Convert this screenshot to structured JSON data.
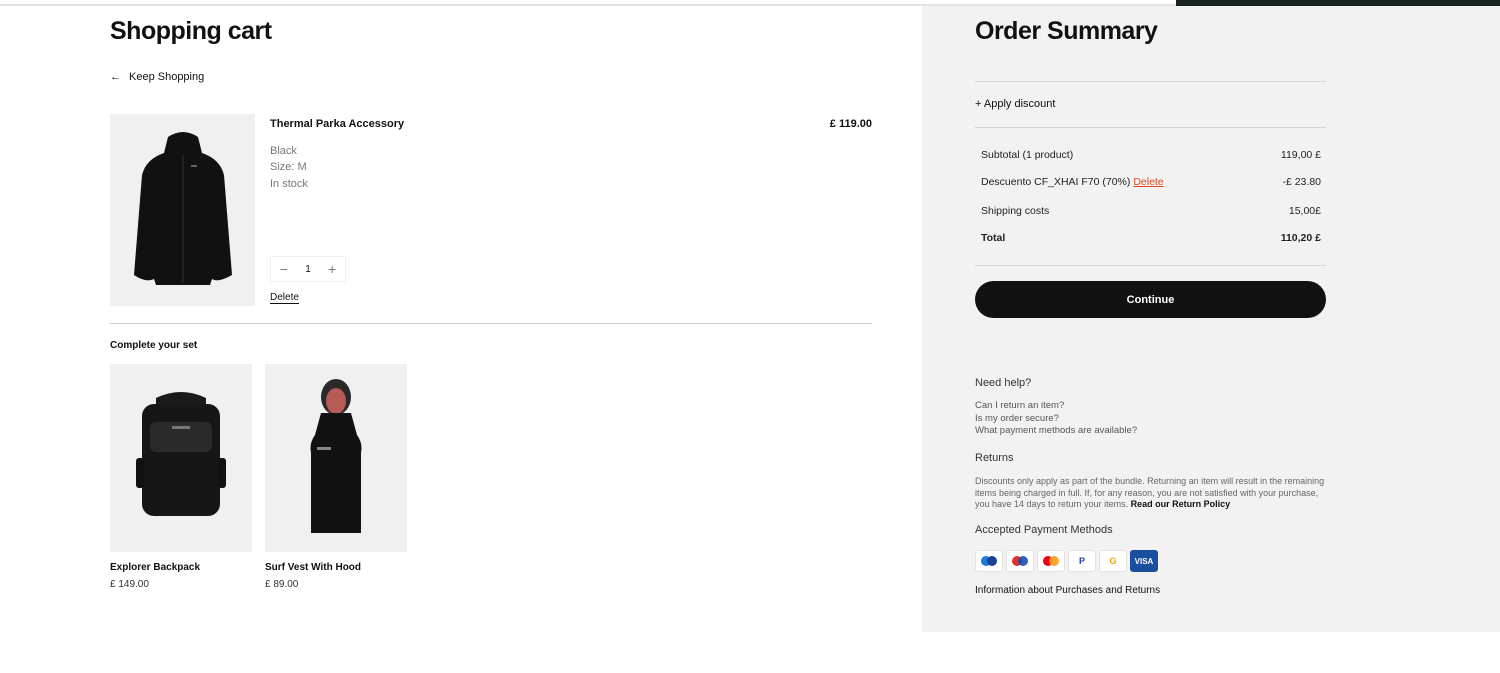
{
  "cart": {
    "title": "Shopping cart",
    "keep_shopping": "Keep Shopping",
    "item": {
      "name": "Thermal Parka Accessory",
      "price": "£ 119.00",
      "color": "Black",
      "size": "Size: M",
      "stock": "In stock",
      "quantity": "1",
      "delete_label": "Delete"
    },
    "complete_title": "Complete your set",
    "recommendations": [
      {
        "name": "Explorer Backpack",
        "price": "£ 149.00"
      },
      {
        "name": "Surf Vest With Hood",
        "price": "£ 89.00"
      }
    ]
  },
  "summary": {
    "title": "Order Summary",
    "apply_discount": "+ Apply discount",
    "subtotal_label": "Subtotal (1 product)",
    "subtotal_value": "119,00 £",
    "discount_label": "Descuento CF_XHAI F70 (70%)",
    "discount_delete": "Delete",
    "discount_value": "-£ 23.80",
    "shipping_label": "Shipping costs",
    "shipping_value": "15,00£",
    "total_label": "Total",
    "total_value": "110,20 £",
    "continue_label": "Continue"
  },
  "help": {
    "title": "Need help?",
    "faqs": [
      "Can I return an item?",
      "Is my order secure?",
      "What payment methods are available?"
    ],
    "returns_title": "Returns",
    "returns_text": "Discounts only apply as part of the bundle. Returning an item will result in the remaining items being charged in full. If, for any reason, you are not satisfied with your purchase, you have 14 days to return your items.",
    "returns_policy": "Read our Return Policy",
    "payment_title": "Accepted Payment Methods",
    "payment_methods": [
      "Maestro",
      "Maestro",
      "Mastercard",
      "PayPal",
      "Google Pay",
      "VISA"
    ],
    "info_link": "Information about Purchases and Returns"
  },
  "colors": {
    "accent_delete": "#e2451f",
    "button_dark": "#111111",
    "summary_bg": "#f2f2f2"
  }
}
